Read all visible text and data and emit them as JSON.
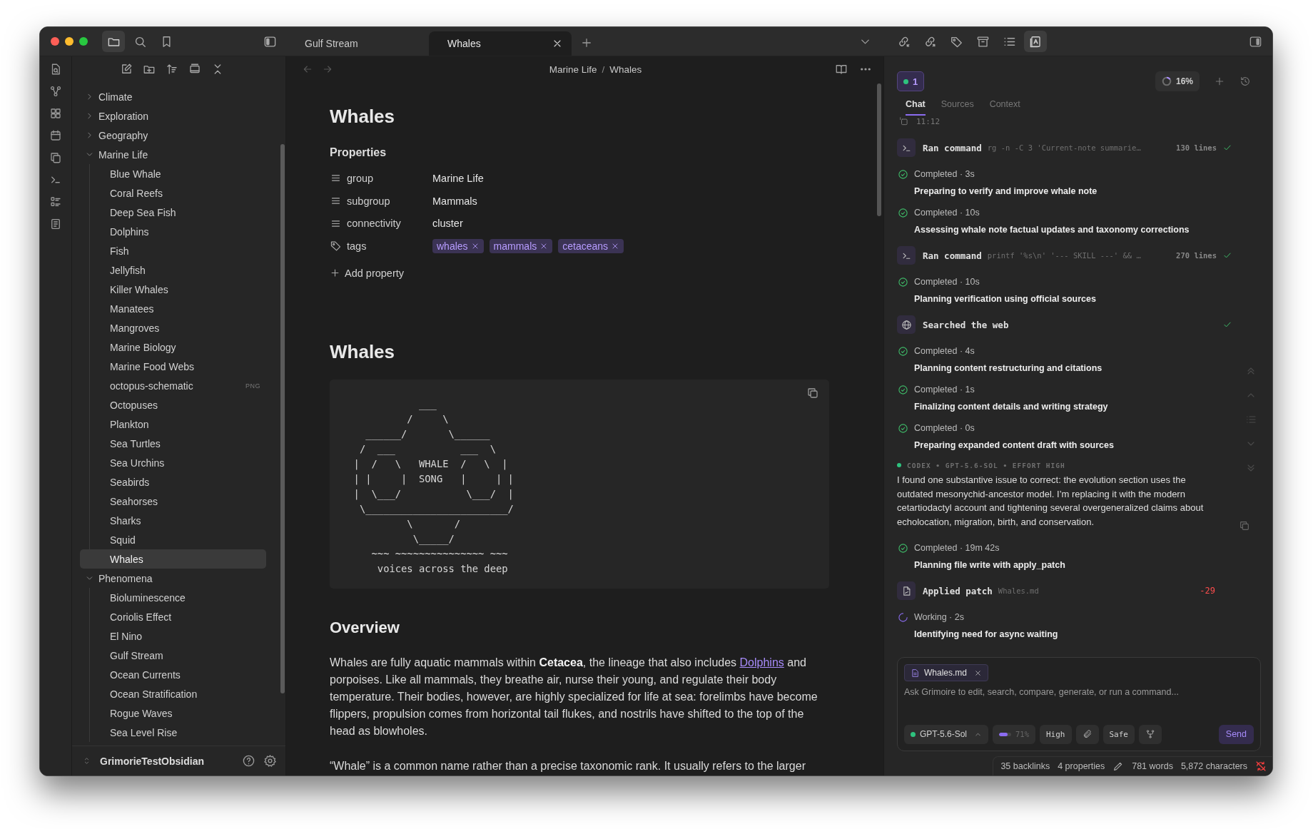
{
  "nav_buttons": [
    {
      "kind": "files",
      "selected": true
    },
    {
      "kind": "search",
      "selected": false
    },
    {
      "kind": "bookmarks",
      "selected": false
    }
  ],
  "tabs": [
    {
      "label": "Gulf Stream",
      "selected": false
    },
    {
      "label": "Whales",
      "selected": true
    }
  ],
  "panel_buttons": [
    {
      "kind": "backlinks",
      "selected": false
    },
    {
      "kind": "outgoing-links",
      "selected": false
    },
    {
      "kind": "tags",
      "selected": false
    },
    {
      "kind": "archive",
      "selected": false
    },
    {
      "kind": "outline",
      "selected": false
    },
    {
      "kind": "reading",
      "selected": true
    }
  ],
  "file_tree": [
    {
      "label": "Climate",
      "kind": "folder",
      "expanded": false,
      "selected": false
    },
    {
      "label": "Exploration",
      "kind": "folder",
      "expanded": false,
      "selected": false
    },
    {
      "label": "Geography",
      "kind": "folder",
      "expanded": false,
      "selected": false
    },
    {
      "label": "Marine Life",
      "kind": "folder",
      "expanded": true,
      "selected": false,
      "children": [
        {
          "label": "Blue Whale",
          "kind": "file",
          "selected": false
        },
        {
          "label": "Coral Reefs",
          "kind": "file",
          "selected": false
        },
        {
          "label": "Deep Sea Fish",
          "kind": "file",
          "selected": false
        },
        {
          "label": "Dolphins",
          "kind": "file",
          "selected": false
        },
        {
          "label": "Fish",
          "kind": "file",
          "selected": false
        },
        {
          "label": "Jellyfish",
          "kind": "file",
          "selected": false
        },
        {
          "label": "Killer Whales",
          "kind": "file",
          "selected": false
        },
        {
          "label": "Manatees",
          "kind": "file",
          "selected": false
        },
        {
          "label": "Mangroves",
          "kind": "file",
          "selected": false
        },
        {
          "label": "Marine Biology",
          "kind": "file",
          "selected": false
        },
        {
          "label": "Marine Food Webs",
          "kind": "file",
          "selected": false
        },
        {
          "label": "octopus-schematic",
          "kind": "file",
          "selected": false,
          "badge": "PNG"
        },
        {
          "label": "Octopuses",
          "kind": "file",
          "selected": false
        },
        {
          "label": "Plankton",
          "kind": "file",
          "selected": false
        },
        {
          "label": "Sea Turtles",
          "kind": "file",
          "selected": false
        },
        {
          "label": "Sea Urchins",
          "kind": "file",
          "selected": false
        },
        {
          "label": "Seabirds",
          "kind": "file",
          "selected": false
        },
        {
          "label": "Seahorses",
          "kind": "file",
          "selected": false
        },
        {
          "label": "Sharks",
          "kind": "file",
          "selected": false
        },
        {
          "label": "Squid",
          "kind": "file",
          "selected": false
        },
        {
          "label": "Whales",
          "kind": "file",
          "selected": true
        }
      ]
    },
    {
      "label": "Phenomena",
      "kind": "folder",
      "expanded": true,
      "selected": false,
      "children": [
        {
          "label": "Bioluminescence",
          "kind": "file",
          "selected": false
        },
        {
          "label": "Coriolis Effect",
          "kind": "file",
          "selected": false
        },
        {
          "label": "El Nino",
          "kind": "file",
          "selected": false
        },
        {
          "label": "Gulf Stream",
          "kind": "file",
          "selected": false
        },
        {
          "label": "Ocean Currents",
          "kind": "file",
          "selected": false
        },
        {
          "label": "Ocean Stratification",
          "kind": "file",
          "selected": false
        },
        {
          "label": "Rogue Waves",
          "kind": "file",
          "selected": false
        },
        {
          "label": "Sea Level Rise",
          "kind": "file",
          "selected": false
        }
      ]
    }
  ],
  "vault": {
    "name": "GrimorieTestObsidian"
  },
  "editor": {
    "breadcrumb": [
      "Marine Life",
      "Whales"
    ],
    "separator": "/",
    "title": "Whales",
    "properties_heading": "Properties",
    "properties": [
      {
        "kind": "text",
        "key": "group",
        "value": "Marine Life"
      },
      {
        "kind": "text",
        "key": "subgroup",
        "value": "Mammals"
      },
      {
        "kind": "text",
        "key": "connectivity",
        "value": "cluster"
      },
      {
        "kind": "tags",
        "key": "tags",
        "values": [
          "whales",
          "mammals",
          "cetaceans"
        ]
      }
    ],
    "add_property": "Add property",
    "heading": "Whales",
    "code_block": "             ___\n           /     \\\n    ______/       \\______\n   /  ___           ___  \\\n  |  /   \\   WHALE  /   \\  |\n  | |     |  SONG   |     | |\n  |  \\___/           \\___/  |\n   \\________________________/\n           \\       /\n            \\_____/\n     ~~~ ~~~~~~~~~~~~~~~ ~~~\n      voices across the deep",
    "section_heading": "Overview",
    "paragraphs": [
      [
        {
          "text": "Whales are fully aquatic mammals within **Cetacea**, the lineage that also includes "
        },
        {
          "link": "Dolphins"
        },
        {
          "text": " and porpoises. Like all mammals, they breathe air, nurse their young, and regulate their body temperature. Their bodies, however, are highly specialized for life at sea: forelimbs have become flippers, propulsion comes from horizontal tail flukes, and nostrils have shifted to the top of the head as blowholes."
        }
      ],
      [
        {
          "text": "“Whale” is a common name rather than a precise taxonomic rank. It usually refers to the larger"
        }
      ]
    ]
  },
  "assistant": {
    "session_count": "1",
    "usage": "16%",
    "tabs": [
      {
        "label": "Chat",
        "selected": true
      },
      {
        "label": "Sources",
        "selected": false
      },
      {
        "label": "Context",
        "selected": false
      }
    ],
    "timestamp": "11:12",
    "feed": [
      {
        "kind": "command",
        "title": "Ran command",
        "detail": "rg -n -C 3 'Current-note summarie…",
        "count": "130 lines",
        "done": true
      },
      {
        "kind": "step",
        "status": "Completed · 3s",
        "title": "Preparing to verify and improve whale note"
      },
      {
        "kind": "step",
        "status": "Completed · 10s",
        "title": "Assessing whale note factual updates and taxonomy corrections"
      },
      {
        "kind": "command",
        "title": "Ran command",
        "detail": "printf '%s\\n' '--- SKILL ---' && …",
        "count": "270 lines",
        "done": true
      },
      {
        "kind": "step",
        "status": "Completed · 10s",
        "title": "Planning verification using official sources"
      },
      {
        "kind": "web",
        "title": "Searched the web",
        "done": true
      },
      {
        "kind": "step",
        "status": "Completed · 4s",
        "title": "Planning content restructuring and citations"
      },
      {
        "kind": "step",
        "status": "Completed · 1s",
        "title": "Finalizing content details and writing strategy"
      },
      {
        "kind": "step",
        "status": "Completed · 0s",
        "title": "Preparing expanded content draft with sources"
      },
      {
        "kind": "message",
        "header": "CODEX • GPT-5.6-SOL • EFFORT HIGH",
        "text": "I found one substantive issue to correct: the evolution section uses the outdated mesonychid-ancestor model. I’m replacing it with the modern cetartiodactyl account and tightening several overgeneralized claims about echolocation, migration, birth, and conservation."
      },
      {
        "kind": "step",
        "status": "Completed · 19m 42s",
        "title": "Planning file write with apply_patch"
      },
      {
        "kind": "patch",
        "title": "Applied patch",
        "detail": "Whales.md",
        "delta": "-29"
      },
      {
        "kind": "working",
        "status": "Working · 2s",
        "title": "Identifying need for async waiting"
      }
    ],
    "composer": {
      "attachment": "Whales.md",
      "placeholder": "Ask Grimoire to edit, search, compare, generate, or run a command...",
      "model": "GPT-5.6-Sol",
      "context": "71%",
      "effort": "High",
      "mode": "Safe",
      "send": "Send"
    }
  },
  "status_bar": {
    "backlinks": "35 backlinks",
    "properties": "4 properties",
    "words": "781 words",
    "characters": "5,872 characters"
  }
}
